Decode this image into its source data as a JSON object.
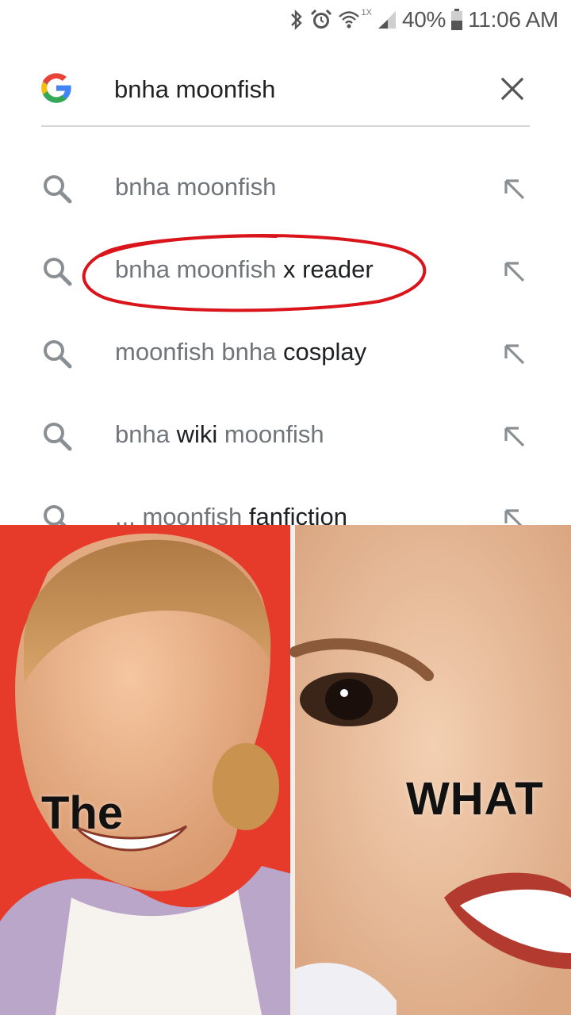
{
  "status_bar": {
    "network_badge": "1X",
    "battery": "40%",
    "time": "11:06 AM",
    "icons": [
      "bluetooth-icon",
      "alarm-icon",
      "wifi-icon",
      "signal-icon",
      "battery-icon"
    ]
  },
  "search": {
    "query": "bnha moonfish",
    "clear_icon": "close-icon"
  },
  "suggestions": [
    {
      "parts": [
        {
          "text": "bnha moonfish",
          "bold": false
        }
      ]
    },
    {
      "parts": [
        {
          "text": "bnha moonfish ",
          "bold": false
        },
        {
          "text": "x reader",
          "bold": true
        }
      ],
      "circled": true
    },
    {
      "parts": [
        {
          "text": "moonfish bnha ",
          "bold": false
        },
        {
          "text": "cosplay",
          "bold": true
        }
      ]
    },
    {
      "parts": [
        {
          "text": "bnha ",
          "bold": false
        },
        {
          "text": "wiki",
          "bold": true
        },
        {
          "text": " moonfish",
          "bold": false
        }
      ]
    },
    {
      "parts": [
        {
          "text": "... moonfish ",
          "bold": false
        },
        {
          "text": "fanfiction",
          "bold": true
        }
      ]
    }
  ],
  "meme": {
    "left_caption": "The",
    "right_caption": "WHAT",
    "colors": {
      "left_bg": "#e63a2a",
      "right_bg": "#f1ddc8",
      "circle": "#d9141b"
    }
  },
  "colors": {
    "suggestion_text": "#70757a",
    "suggestion_bold": "#202124",
    "divider": "#d6d6d6"
  }
}
